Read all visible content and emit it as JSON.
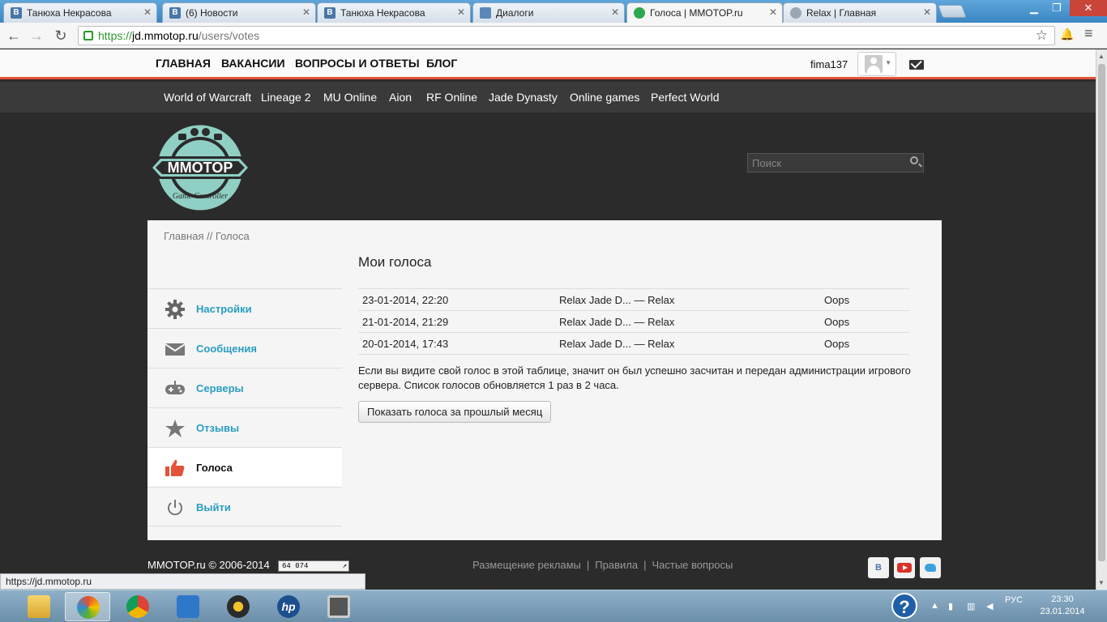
{
  "browser": {
    "tabs": [
      {
        "label": "Танюха Некрасова",
        "icon": "vk-icon",
        "icon_glyph": "В"
      },
      {
        "label": "(6) Новости",
        "icon": "vk-icon",
        "icon_glyph": "В"
      },
      {
        "label": "Танюха Некрасова",
        "icon": "vk-icon",
        "icon_glyph": "В"
      },
      {
        "label": "Диалоги",
        "icon": "dialogs-icon",
        "icon_glyph": ""
      },
      {
        "label": "Голоса | MMOTOP.ru",
        "icon": "mmotop-icon",
        "icon_glyph": "",
        "active": true
      },
      {
        "label": "Relax | Главная",
        "icon": "relax-icon",
        "icon_glyph": ""
      }
    ],
    "url": {
      "scheme": "https://",
      "host": "jd.mmotop.ru",
      "path": "/users/votes"
    }
  },
  "topnav": {
    "items": [
      "ГЛАВНАЯ",
      "ВАКАНСИИ",
      "ВОПРОСЫ И ОТВЕТЫ",
      "БЛОГ"
    ],
    "username": "fima137"
  },
  "gamenav": [
    "World of Warcraft",
    "Lineage 2",
    "MU Online",
    "Aion",
    "RF Online",
    "Jade Dynasty",
    "Online games",
    "Perfect World"
  ],
  "logo": {
    "text": "MMOTOP",
    "subtitle": "Game Controller"
  },
  "search": {
    "placeholder": "Поиск"
  },
  "breadcrumb": "Главная // Голоса",
  "sidebar": [
    {
      "label": "Настройки",
      "icon": "gear-icon"
    },
    {
      "label": "Сообщения",
      "icon": "envelope-icon"
    },
    {
      "label": "Серверы",
      "icon": "gamepad-icon"
    },
    {
      "label": "Отзывы",
      "icon": "star-icon"
    },
    {
      "label": "Голоса",
      "icon": "thumbs-up-icon",
      "active": true
    },
    {
      "label": "Выйти",
      "icon": "power-icon"
    }
  ],
  "main": {
    "title": "Мои голоса",
    "votes": [
      {
        "date": "23-01-2014, 22:20",
        "server": "Relax Jade D... — Relax",
        "status": "Oops"
      },
      {
        "date": "21-01-2014, 21:29",
        "server": "Relax Jade D... — Relax",
        "status": "Oops"
      },
      {
        "date": "20-01-2014, 17:43",
        "server": "Relax Jade D... — Relax",
        "status": "Oops"
      }
    ],
    "note": "Если вы видите свой голос в этой таблице, значит он был успешно засчитан и передан администрации игрового сервера. Список голосов обновляется 1 раз в 2 часа.",
    "button_label": "Показать голоса за прошлый месяц"
  },
  "footer": {
    "copyright": "MMOTOP.ru © 2006-2014",
    "counter": "64 074",
    "links": [
      "Размещение рекламы",
      "Правила",
      "Частые вопросы"
    ],
    "link_separator": "|",
    "social": [
      "В"
    ]
  },
  "status_url": "https://jd.mmotop.ru",
  "taskbar": {
    "lang": "РУС",
    "time": "23:30",
    "date": "23.01.2014"
  },
  "colors": {
    "accent": "#e2533a",
    "link": "#2a9dc3",
    "gamenav_bg": "#3a3a3a",
    "page_bg": "#2b2b2b"
  }
}
